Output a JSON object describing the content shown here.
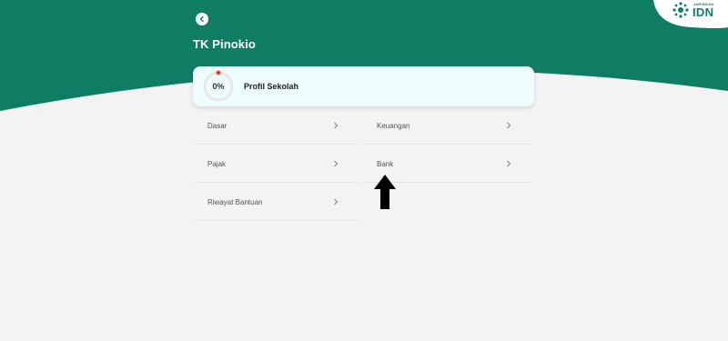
{
  "header": {
    "title": "TK Pinokio",
    "back_icon": "chevron-left-icon",
    "brand_color": "#0e7d63"
  },
  "logo": {
    "small_text": "JARINGAN",
    "big_text": "IDN"
  },
  "profile_card": {
    "progress_text": "0%",
    "progress_fraction": 0,
    "label": "Profil Sekolah",
    "indicator_color": "#e53935"
  },
  "menu": {
    "items": [
      {
        "label": "Dasar"
      },
      {
        "label": "Keuangan"
      },
      {
        "label": "Pajak"
      },
      {
        "label": "Bank"
      },
      {
        "label": "Riwayat Bantuan"
      }
    ]
  }
}
